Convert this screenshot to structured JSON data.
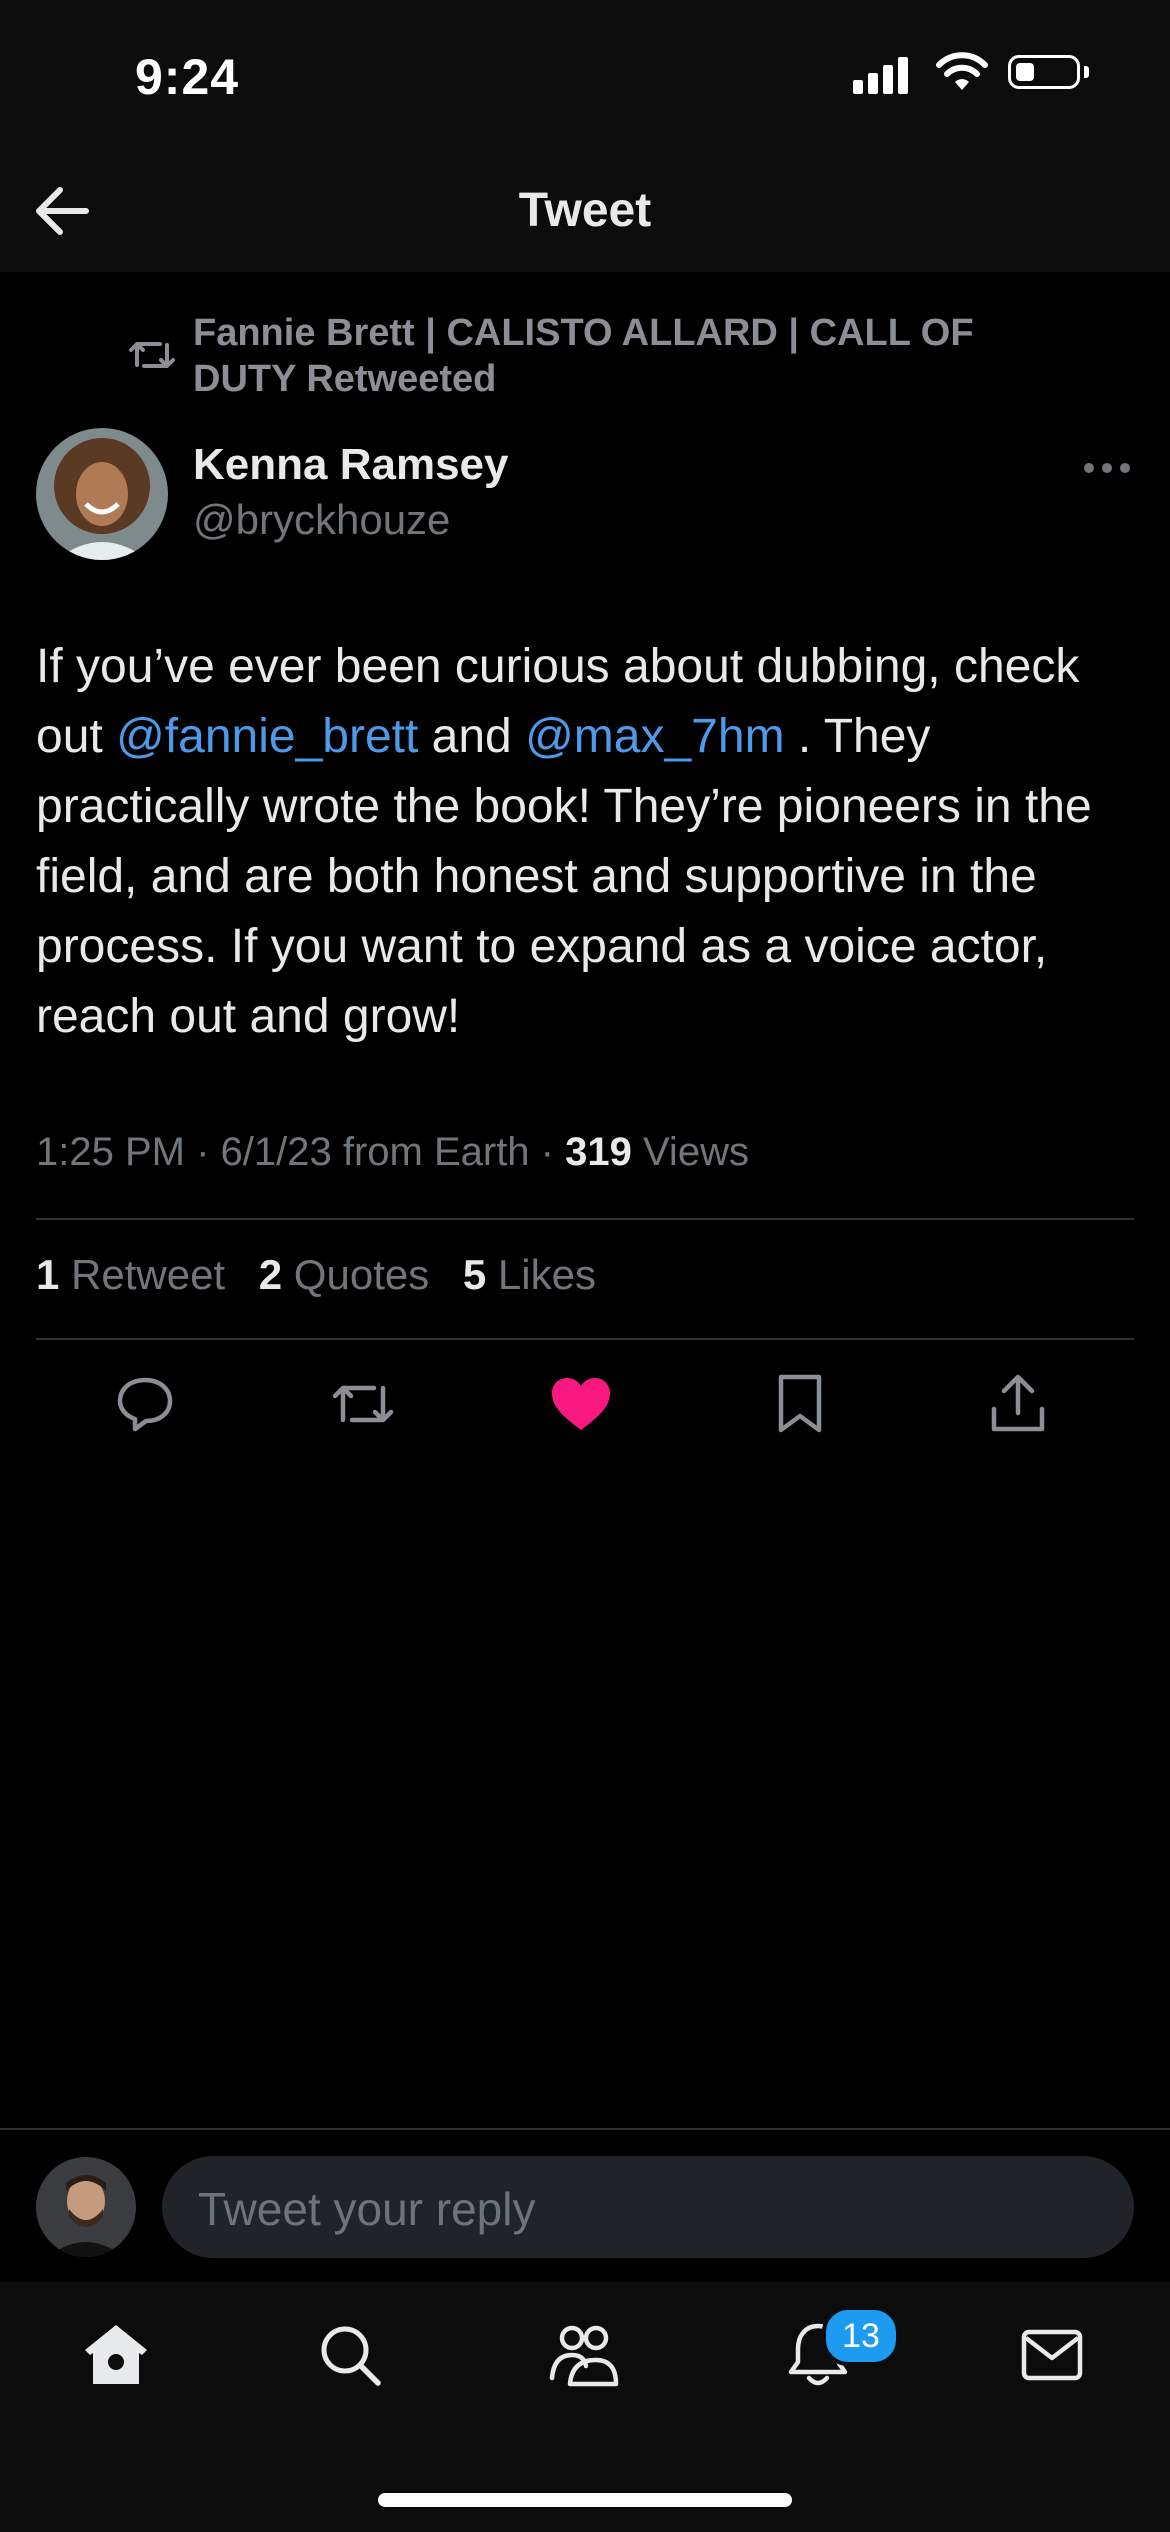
{
  "status_bar": {
    "time": "9:24"
  },
  "header": {
    "title": "Tweet"
  },
  "retweet": {
    "text": "Fannie Brett | CALISTO ALLARD | CALL OF DUTY Retweeted"
  },
  "author": {
    "name": "Kenna Ramsey",
    "handle": "@bryckhouze"
  },
  "tweet": {
    "part1": "If you’ve ever been curious about dubbing, check out ",
    "mention1": "@fannie_brett",
    "part2": "  and ",
    "mention2": "@max_7hm",
    "part3": " . They practically wrote the book! They’re pioneers in the field, and are both honest and supportive in the process. If you want to expand as a voice actor, reach out and grow!"
  },
  "meta": {
    "timestamp": "1:25 PM · 6/1/23 from Earth · ",
    "views_count": "319",
    "views_label": " Views"
  },
  "stats": {
    "retweets_count": "1",
    "retweets_label": " Retweet",
    "quotes_count": "2",
    "quotes_label": " Quotes",
    "likes_count": "5",
    "likes_label": " Likes"
  },
  "actions": [
    "reply-icon",
    "retweet-icon",
    "heart-icon",
    "bookmark-icon",
    "share-icon"
  ],
  "colors": {
    "accent": "#1d9bf0",
    "mention": "#4e9ae8",
    "like": "#f91880"
  },
  "reply": {
    "placeholder": "Tweet your reply"
  },
  "tabbar": {
    "items": [
      "home-icon",
      "search-icon",
      "communities-icon",
      "notifications-icon",
      "messages-icon"
    ],
    "notifications_badge": "13"
  }
}
